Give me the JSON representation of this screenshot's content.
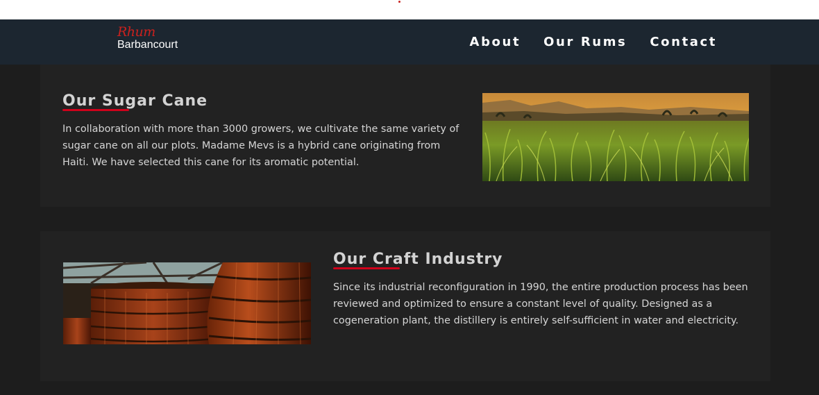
{
  "header": {
    "logo": {
      "script": "Rhum",
      "brand": "Barbancourt"
    },
    "nav": [
      {
        "label": "About"
      },
      {
        "label": "Our Rums"
      },
      {
        "label": "Contact"
      }
    ]
  },
  "sections": [
    {
      "title": "Our Sugar Cane",
      "text": "In collaboration with more than 3000 growers, we cultivate the same variety of sugar cane on all our plots. Madame Mevs is a hybrid cane originating from Haiti. We have selected this cane for its aromatic potential.",
      "image": "sugar-cane-field-at-sunset"
    },
    {
      "title": "Our Craft Industry",
      "text": "Since its industrial reconfiguration in 1990, the entire production process has been reviewed and optimized to ensure a constant level of quality. Designed as a cogeneration plant, the distillery is entirely self-sufficient in water and electricity.",
      "image": "wooden-rum-vats-in-distillery"
    }
  ],
  "colors": {
    "accent": "#d0021b",
    "navbar": "#1c2630",
    "page": "#1d1d1d",
    "card": "#222222"
  }
}
